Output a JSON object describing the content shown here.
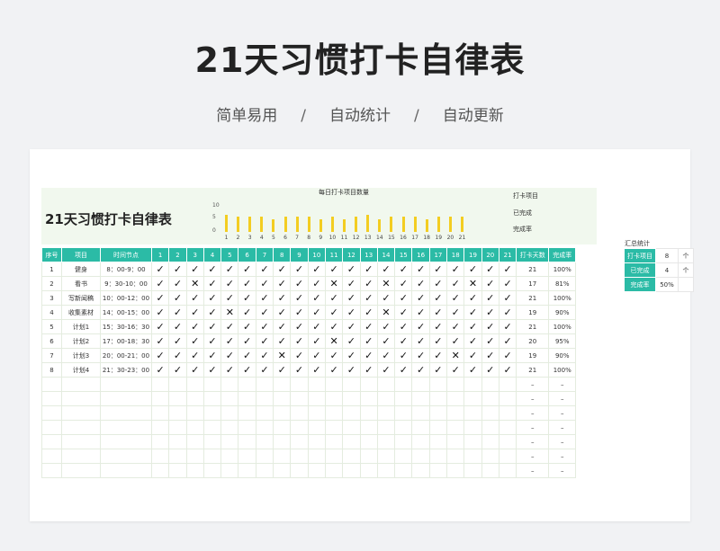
{
  "page": {
    "title": "21天习惯打卡自律表",
    "subtitle": [
      "简单易用",
      "自动统计",
      "自动更新"
    ],
    "separator": "/"
  },
  "sheet": {
    "title": "21天习惯打卡自律表",
    "legend": [
      "打卡项目",
      "已完成",
      "完成率"
    ]
  },
  "chart_data": {
    "type": "bar",
    "title": "每日打卡项目数量",
    "categories": [
      "1",
      "2",
      "3",
      "4",
      "5",
      "6",
      "7",
      "8",
      "9",
      "10",
      "11",
      "12",
      "13",
      "14",
      "15",
      "16",
      "17",
      "18",
      "19",
      "20",
      "21"
    ],
    "values": [
      8,
      7,
      7,
      7,
      6,
      7,
      7,
      7,
      6,
      7,
      6,
      7,
      8,
      6,
      7,
      7,
      7,
      6,
      7,
      7,
      7
    ],
    "yticks": [
      "10",
      "5",
      "0"
    ],
    "ylim": [
      0,
      10
    ],
    "color": "#f3cd21"
  },
  "table": {
    "headers": [
      "序号",
      "项目",
      "时间节点",
      "1",
      "2",
      "3",
      "4",
      "5",
      "6",
      "7",
      "8",
      "9",
      "10",
      "11",
      "12",
      "13",
      "14",
      "15",
      "16",
      "17",
      "18",
      "19",
      "20",
      "21",
      "打卡天数",
      "完成率"
    ],
    "rows": [
      {
        "no": "1",
        "item": "健身",
        "time": "8：00-9：00",
        "marks": [
          "✓",
          "✓",
          "✓",
          "✓",
          "✓",
          "✓",
          "✓",
          "✓",
          "✓",
          "✓",
          "✓",
          "✓",
          "✓",
          "✓",
          "✓",
          "✓",
          "✓",
          "✓",
          "✓",
          "✓",
          "✓"
        ],
        "days": "21",
        "rate": "100%"
      },
      {
        "no": "2",
        "item": "看书",
        "time": "9：30-10：00",
        "marks": [
          "✓",
          "✓",
          "✕",
          "✓",
          "✓",
          "✓",
          "✓",
          "✓",
          "✓",
          "✓",
          "✕",
          "✓",
          "✓",
          "✕",
          "✓",
          "✓",
          "✓",
          "✓",
          "✕",
          "✓",
          "✓"
        ],
        "days": "17",
        "rate": "81%"
      },
      {
        "no": "3",
        "item": "写新闻稿",
        "time": "10：00-12：00",
        "marks": [
          "✓",
          "✓",
          "✓",
          "✓",
          "✓",
          "✓",
          "✓",
          "✓",
          "✓",
          "✓",
          "✓",
          "✓",
          "✓",
          "✓",
          "✓",
          "✓",
          "✓",
          "✓",
          "✓",
          "✓",
          "✓"
        ],
        "days": "21",
        "rate": "100%"
      },
      {
        "no": "4",
        "item": "收集素材",
        "time": "14：00-15：00",
        "marks": [
          "✓",
          "✓",
          "✓",
          "✓",
          "✕",
          "✓",
          "✓",
          "✓",
          "✓",
          "✓",
          "✓",
          "✓",
          "✓",
          "✕",
          "✓",
          "✓",
          "✓",
          "✓",
          "✓",
          "✓",
          "✓"
        ],
        "days": "19",
        "rate": "90%"
      },
      {
        "no": "5",
        "item": "计划1",
        "time": "15：30-16：30",
        "marks": [
          "✓",
          "✓",
          "✓",
          "✓",
          "✓",
          "✓",
          "✓",
          "✓",
          "✓",
          "✓",
          "✓",
          "✓",
          "✓",
          "✓",
          "✓",
          "✓",
          "✓",
          "✓",
          "✓",
          "✓",
          "✓"
        ],
        "days": "21",
        "rate": "100%"
      },
      {
        "no": "6",
        "item": "计划2",
        "time": "17：00-18：30",
        "marks": [
          "✓",
          "✓",
          "✓",
          "✓",
          "✓",
          "✓",
          "✓",
          "✓",
          "✓",
          "✓",
          "✕",
          "✓",
          "✓",
          "✓",
          "✓",
          "✓",
          "✓",
          "✓",
          "✓",
          "✓",
          "✓"
        ],
        "days": "20",
        "rate": "95%"
      },
      {
        "no": "7",
        "item": "计划3",
        "time": "20：00-21：00",
        "marks": [
          "✓",
          "✓",
          "✓",
          "✓",
          "✓",
          "✓",
          "✓",
          "✕",
          "✓",
          "✓",
          "✓",
          "✓",
          "✓",
          "✓",
          "✓",
          "✓",
          "✓",
          "✕",
          "✓",
          "✓",
          "✓"
        ],
        "days": "19",
        "rate": "90%"
      },
      {
        "no": "8",
        "item": "计划4",
        "time": "21：30-23：00",
        "marks": [
          "✓",
          "✓",
          "✓",
          "✓",
          "✓",
          "✓",
          "✓",
          "✓",
          "✓",
          "✓",
          "✓",
          "✓",
          "✓",
          "✓",
          "✓",
          "✓",
          "✓",
          "✓",
          "✓",
          "✓",
          "✓"
        ],
        "days": "21",
        "rate": "100%"
      }
    ],
    "empty_rows": 7,
    "dash": "–"
  },
  "summary": {
    "title": "汇总统计",
    "rows": [
      {
        "label": "打卡项目",
        "value": "8",
        "unit": "个"
      },
      {
        "label": "已完成",
        "value": "4",
        "unit": "个"
      },
      {
        "label": "完成率",
        "value": "50%",
        "unit": ""
      }
    ]
  }
}
